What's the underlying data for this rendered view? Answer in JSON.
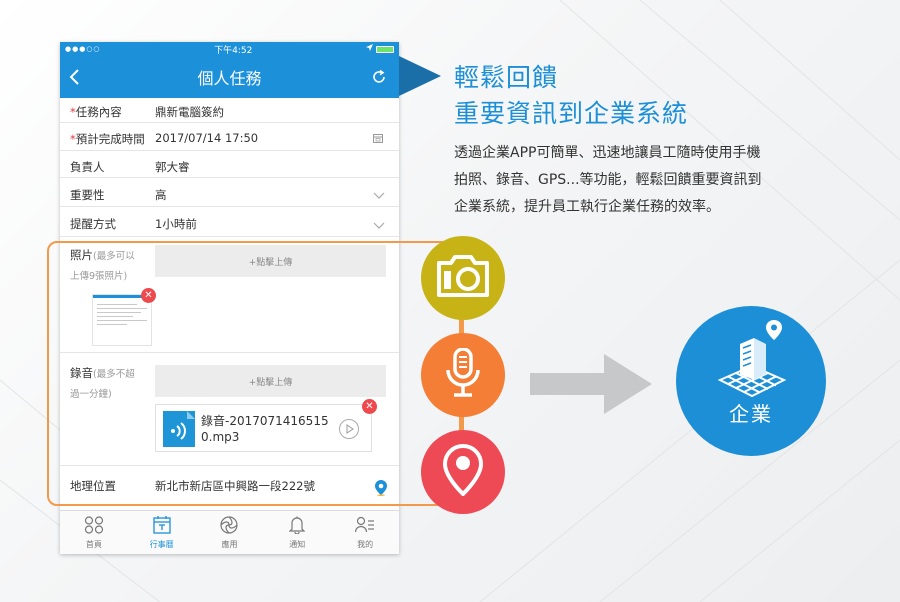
{
  "status_bar": {
    "signal": "●●●○○",
    "time": "下午4:52"
  },
  "header": {
    "title": "個人任務"
  },
  "form": {
    "task_content": {
      "required_mark": "*",
      "label": "任務內容",
      "value": "鼎新電腦簽約"
    },
    "due_time": {
      "required_mark": "*",
      "label": "預計完成時間",
      "value": "2017/07/14 17:50"
    },
    "owner": {
      "label": "負責人",
      "value": "郭大睿"
    },
    "importance": {
      "label": "重要性",
      "value": "高"
    },
    "reminder": {
      "label": "提醒方式",
      "value": "1小時前"
    },
    "photo": {
      "label": "照片",
      "hint_line1": "(最多可以",
      "hint_line2": "上傳9張照片)",
      "upload_label": "+點擊上傳"
    },
    "audio": {
      "label": "錄音",
      "hint_line1": "(最多不超",
      "hint_line2": "過一分鐘)",
      "upload_label": "+點擊上傳",
      "file_line1": "錄音-2017071416515",
      "file_line2": "0.mp3"
    },
    "location": {
      "label": "地理位置",
      "value": "新北市新店區中興路一段222號"
    },
    "close_glyph": "✕"
  },
  "tabs": [
    {
      "label": "首頁",
      "icon": "home-grid-icon"
    },
    {
      "label": "行事曆",
      "icon": "calendar-icon"
    },
    {
      "label": "應用",
      "icon": "apps-icon"
    },
    {
      "label": "通知",
      "icon": "bell-icon"
    },
    {
      "label": "我的",
      "icon": "profile-icon"
    }
  ],
  "promo": {
    "headline_line1": "輕鬆回饋",
    "headline_line2": "重要資訊到企業系統",
    "description_line1": "透過企業APP可簡單、迅速地讓員工隨時使用手機",
    "description_line2": "拍照、錄音、GPS...等功能，輕鬆回饋重要資訊到",
    "description_line3": "企業系統，提升員工執行企業任務的效率。",
    "enterprise_label": "企業"
  },
  "colors": {
    "brand_blue": "#1c90d8",
    "camera_circle": "#c7b316",
    "mic_circle": "#f47e35",
    "gps_circle": "#ee4a55",
    "highlight_orange": "#f29a4a"
  }
}
